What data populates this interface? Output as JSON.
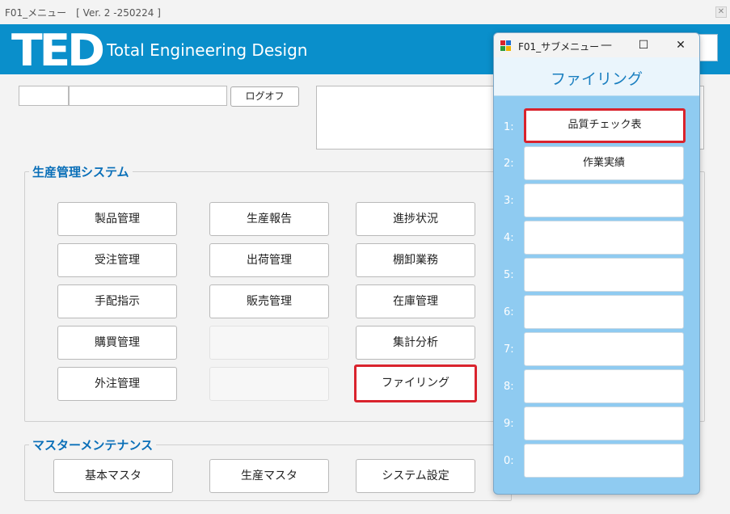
{
  "window": {
    "title": "F01_メニュー　[ Ver. 2 -250224 ]",
    "close": "✕"
  },
  "banner": {
    "logo": "TED",
    "tagline": "Total Engineering Design"
  },
  "login": {
    "logoff_label": "ログオフ"
  },
  "production": {
    "group_label": "生産管理システム",
    "buttons": [
      "製品管理",
      "生産報告",
      "進捗状況",
      "受注管理",
      "出荷管理",
      "棚卸業務",
      "手配指示",
      "販売管理",
      "在庫管理",
      "購買管理",
      "",
      "集計分析",
      "外注管理",
      "",
      "ファイリング"
    ]
  },
  "master": {
    "group_label": "マスターメンテナンス",
    "buttons": [
      "基本マスタ",
      "生産マスタ",
      "システム設定"
    ]
  },
  "submenu": {
    "title": "F01_サブメニュー",
    "minimize": "—",
    "maximize": "☐",
    "close": "✕",
    "heading": "ファイリング",
    "items": [
      {
        "num": "1:",
        "label": "品質チェック表"
      },
      {
        "num": "2:",
        "label": "作業実績"
      },
      {
        "num": "3:",
        "label": ""
      },
      {
        "num": "4:",
        "label": ""
      },
      {
        "num": "5:",
        "label": ""
      },
      {
        "num": "6:",
        "label": ""
      },
      {
        "num": "7:",
        "label": ""
      },
      {
        "num": "8:",
        "label": ""
      },
      {
        "num": "9:",
        "label": ""
      },
      {
        "num": "0:",
        "label": ""
      }
    ]
  },
  "colors": {
    "brand": "#0a8fcb",
    "highlight": "#d9232d",
    "submenu_bg": "#8fcbf1",
    "group_label": "#0a6fb8"
  }
}
